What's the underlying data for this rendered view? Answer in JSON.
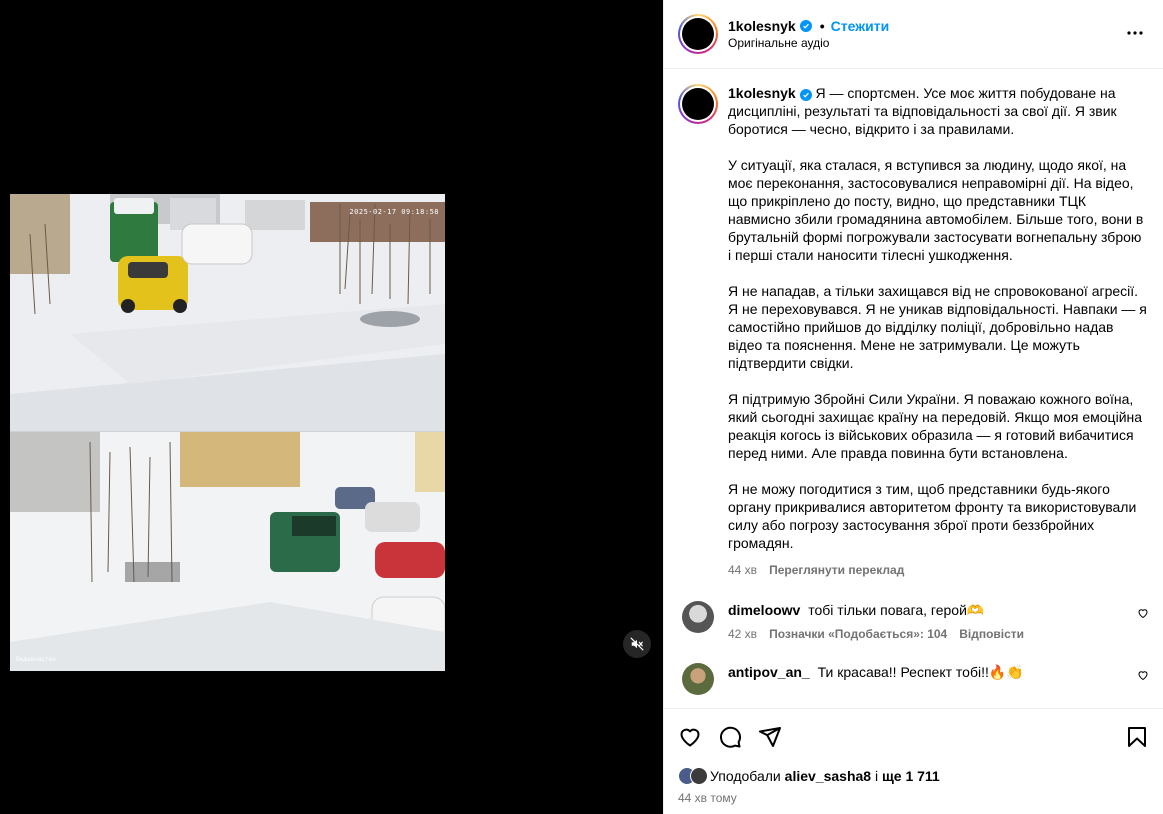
{
  "post": {
    "username": "1kolesnyk",
    "separator": "•",
    "follow_label": "Стежити",
    "audio_label": "Оригінальне аудіо"
  },
  "video": {
    "timestamp": "2025-02-17 09:18:58",
    "watermark": "Видавництво",
    "muted": true
  },
  "caption": {
    "username": "1kolesnyk",
    "paragraphs": [
      "Я — спортсмен. Усе моє життя побудоване на дисципліні, результаті та відповідальності за свої дії. Я звик боротися — чесно, відкрито і за правилами.",
      "У ситуації, яка сталася, я вступився за людину, щодо якої, на моє переконання, застосовувалися неправомірні дії. На відео, що прикріплено до посту, видно, що представники ТЦК навмисно збили громадянина автомобілем. Більше того, вони в брутальній формі погрожували застосувати вогнепальну зброю і перші стали наносити тілесні ушкодження.",
      "Я не нападав, а тільки захищався від не спровокованої агресії. Я не переховувався. Я не уникав відповідальності. Навпаки — я самостійно прийшов до відділку поліції, добровільно надав відео та пояснення. Мене не затримували. Це можуть підтвердити свідки.",
      "Я підтримую Збройні Сили України. Я поважаю кожного воїна, який сьогодні захищає країну на передовій. Якщо моя емоційна реакція когось із військових образила — я готовий вибачитися перед ними. Але правда повинна бути встановлена.",
      "Я не можу погодитися з тим, щоб представники будь-якого органу прикривалися авторитетом фронту та використовували силу або погрозу застосування зброї проти беззбройних громадян."
    ],
    "time": "44 хв",
    "translate_label": "Переглянути переклад"
  },
  "comments": [
    {
      "username": "dimeloowv",
      "text": "тобі тільки повага, герой🫶",
      "time": "42 хв",
      "likes_label": "Позначки «Подобається»: 104",
      "reply_label": "Відповісти"
    },
    {
      "username": "antipov_an_",
      "text": "Ти красава!! Респект тобі!!🔥👏",
      "time": "",
      "likes_label": "",
      "reply_label": ""
    }
  ],
  "footer": {
    "liked_by_prefix": "Уподобали",
    "liked_by_user": "aliev_sasha8",
    "liked_by_and": "і",
    "liked_by_more": "ще 1 711",
    "time": "44 хв тому"
  },
  "colors": {
    "accent": "#0095f6",
    "muted_text": "#737373",
    "border": "#efefef"
  },
  "icons": [
    "verified-icon",
    "more-icon",
    "mute-icon",
    "heart-icon",
    "comment-icon",
    "share-icon",
    "save-icon"
  ]
}
